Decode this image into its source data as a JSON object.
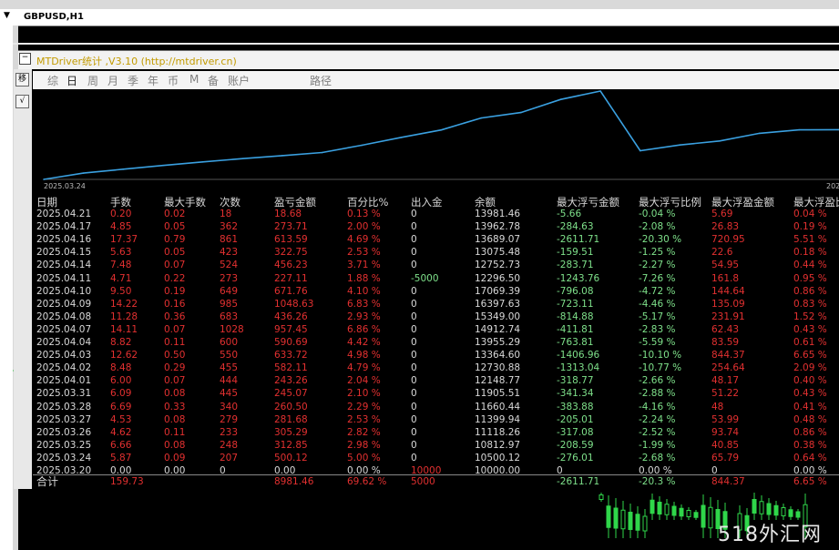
{
  "window": {
    "symbol_label": "GBPUSD,H1"
  },
  "panel": {
    "title": "MTDriver统计 ,V3.10 (http://mtdriver.cn)",
    "side_icons": [
      "移",
      "√"
    ],
    "menu": [
      {
        "label": "综",
        "active": false
      },
      {
        "label": "日",
        "active": true
      },
      {
        "label": "周",
        "active": false
      },
      {
        "label": "月",
        "active": false
      },
      {
        "label": "季",
        "active": false
      },
      {
        "label": "年",
        "active": false
      },
      {
        "label": "币",
        "active": false
      },
      {
        "label": "M",
        "active": false
      },
      {
        "label": "备",
        "active": false
      },
      {
        "label": "账户",
        "active": false
      },
      {
        "label": "路径",
        "active": false
      }
    ]
  },
  "chart_data": {
    "type": "line",
    "x_start_label": "2025.03.24",
    "x_end_label": "202",
    "series": [
      {
        "color": "#3aa0e0",
        "values": [
          10000.0,
          10500.12,
          10812.97,
          11118.26,
          11399.94,
          11660.44,
          11905.51,
          12148.77,
          12730.88,
          13364.6,
          13955.29,
          14912.74,
          15349.0,
          16397.63,
          17069.39,
          12296.5,
          12752.73,
          13075.48,
          13689.07,
          13962.78,
          13981.46
        ]
      }
    ]
  },
  "table": {
    "headers": [
      "日期",
      "手数",
      "最大手数",
      "次数",
      "盈亏金额",
      "百分比%",
      "出入金",
      "余额",
      "最大浮亏金额",
      "最大浮亏比例",
      "最大浮盈金额",
      "最大浮盈比"
    ],
    "rows": [
      [
        "2025.04.21",
        "0.20",
        "0.02",
        "18",
        "18.68",
        "0.13 %",
        "0",
        "13981.46",
        "-5.66",
        "-0.04 %",
        "5.69",
        "0.04 %"
      ],
      [
        "2025.04.17",
        "4.85",
        "0.05",
        "362",
        "273.71",
        "2.00 %",
        "0",
        "13962.78",
        "-284.63",
        "-2.08 %",
        "26.83",
        "0.19 %"
      ],
      [
        "2025.04.16",
        "17.37",
        "0.79",
        "861",
        "613.59",
        "4.69 %",
        "0",
        "13689.07",
        "-2611.71",
        "-20.30 %",
        "720.95",
        "5.51 %"
      ],
      [
        "2025.04.15",
        "5.63",
        "0.05",
        "423",
        "322.75",
        "2.53 %",
        "0",
        "13075.48",
        "-159.51",
        "-1.25 %",
        "22.6",
        "0.18 %"
      ],
      [
        "2025.04.14",
        "7.48",
        "0.07",
        "524",
        "456.23",
        "3.71 %",
        "0",
        "12752.73",
        "-283.71",
        "-2.27 %",
        "54.95",
        "0.44 %"
      ],
      [
        "2025.04.11",
        "4.71",
        "0.22",
        "273",
        "227.11",
        "1.88 %",
        "-5000",
        "12296.50",
        "-1243.76",
        "-7.26 %",
        "161.8",
        "0.95 %"
      ],
      [
        "2025.04.10",
        "9.50",
        "0.19",
        "649",
        "671.76",
        "4.10 %",
        "0",
        "17069.39",
        "-796.08",
        "-4.72 %",
        "144.64",
        "0.86 %"
      ],
      [
        "2025.04.09",
        "14.22",
        "0.16",
        "985",
        "1048.63",
        "6.83 %",
        "0",
        "16397.63",
        "-723.11",
        "-4.46 %",
        "135.09",
        "0.83 %"
      ],
      [
        "2025.04.08",
        "11.28",
        "0.36",
        "683",
        "436.26",
        "2.93 %",
        "0",
        "15349.00",
        "-814.88",
        "-5.17 %",
        "231.91",
        "1.52 %"
      ],
      [
        "2025.04.07",
        "14.11",
        "0.07",
        "1028",
        "957.45",
        "6.86 %",
        "0",
        "14912.74",
        "-411.81",
        "-2.83 %",
        "62.43",
        "0.43 %"
      ],
      [
        "2025.04.04",
        "8.82",
        "0.11",
        "600",
        "590.69",
        "4.42 %",
        "0",
        "13955.29",
        "-763.81",
        "-5.59 %",
        "83.59",
        "0.61 %"
      ],
      [
        "2025.04.03",
        "12.62",
        "0.50",
        "550",
        "633.72",
        "4.98 %",
        "0",
        "13364.60",
        "-1406.96",
        "-10.10 %",
        "844.37",
        "6.65 %"
      ],
      [
        "2025.04.02",
        "8.48",
        "0.29",
        "455",
        "582.11",
        "4.79 %",
        "0",
        "12730.88",
        "-1313.04",
        "-10.77 %",
        "254.64",
        "2.09 %"
      ],
      [
        "2025.04.01",
        "6.00",
        "0.07",
        "444",
        "243.26",
        "2.04 %",
        "0",
        "12148.77",
        "-318.77",
        "-2.66 %",
        "48.17",
        "0.40 %"
      ],
      [
        "2025.03.31",
        "6.09",
        "0.08",
        "445",
        "245.07",
        "2.10 %",
        "0",
        "11905.51",
        "-341.34",
        "-2.88 %",
        "51.22",
        "0.43 %"
      ],
      [
        "2025.03.28",
        "6.69",
        "0.33",
        "340",
        "260.50",
        "2.29 %",
        "0",
        "11660.44",
        "-383.88",
        "-4.16 %",
        "48",
        "0.41 %"
      ],
      [
        "2025.03.27",
        "4.53",
        "0.08",
        "279",
        "281.68",
        "2.53 %",
        "0",
        "11399.94",
        "-205.01",
        "-2.24 %",
        "53.99",
        "0.48 %"
      ],
      [
        "2025.03.26",
        "4.62",
        "0.11",
        "233",
        "305.29",
        "2.82 %",
        "0",
        "11118.26",
        "-317.08",
        "-2.52 %",
        "93.74",
        "0.86 %"
      ],
      [
        "2025.03.25",
        "6.66",
        "0.08",
        "248",
        "312.85",
        "2.98 %",
        "0",
        "10812.97",
        "-208.59",
        "-1.99 %",
        "40.85",
        "0.38 %"
      ],
      [
        "2025.03.24",
        "5.87",
        "0.09",
        "207",
        "500.12",
        "5.00 %",
        "0",
        "10500.12",
        "-276.01",
        "-2.68 %",
        "65.79",
        "0.64 %"
      ],
      [
        "2025.03.20",
        "0.00",
        "0.00",
        "0",
        "0.00",
        "0.00 %",
        "10000",
        "10000.00",
        "0",
        "0.00 %",
        "0",
        "0.00 %"
      ]
    ],
    "total": [
      "合计",
      "159.73",
      "",
      "",
      "8981.46",
      "69.62 %",
      "5000",
      "",
      "-2611.71",
      "-20.3 %",
      "844.37",
      "6.65 %"
    ]
  },
  "watermark": "518外汇网",
  "colors": {
    "profit": "#e23030",
    "loss": "#7ee08a",
    "line": "#3aa0e0",
    "panel_title": "#c39b00"
  }
}
